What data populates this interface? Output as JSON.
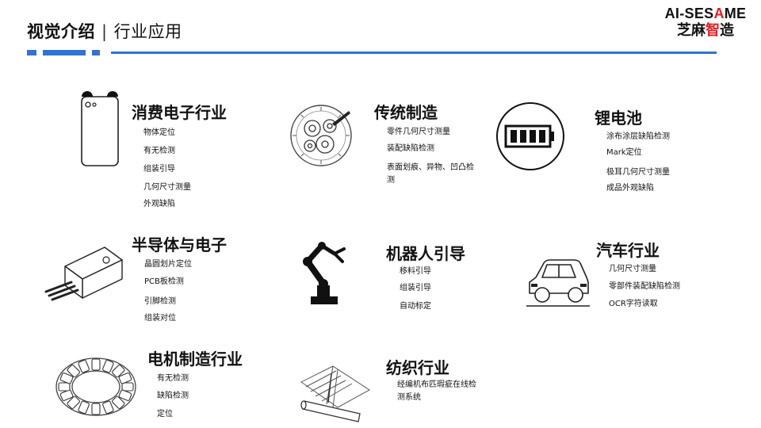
{
  "header": {
    "title": "视觉介绍",
    "separator": "|",
    "subtitle": "行业应用"
  },
  "brand": {
    "en_prefix": "AI-SES",
    "en_mid": "A",
    "en_suffix": "ME",
    "cn_part1": "芝麻",
    "cn_part2": "智",
    "cn_part3": "造"
  },
  "colors": {
    "accent_blue": "#2f73d6",
    "brand_red": "#e51c23",
    "text": "#111111"
  },
  "categories": [
    {
      "icon": "smartphone-icon",
      "title": "消费电子行业",
      "items": [
        "物体定位",
        "有无检测",
        "组装引导",
        "几何尺寸测量",
        "外观缺陷"
      ]
    },
    {
      "icon": "watch-mechanism-icon",
      "title": "传统制造",
      "items": [
        "零件几何尺寸测量",
        "装配缺陷检测",
        "表面划痕、异物、凹凸检测"
      ]
    },
    {
      "icon": "battery-icon",
      "title": "锂电池",
      "items": [
        "涂布涂层缺陷检测",
        "Mark定位",
        "极耳几何尺寸测量",
        "成品外观缺陷"
      ]
    },
    {
      "icon": "transistor-chip-icon",
      "title": "半导体与电子",
      "items": [
        "晶圆划片定位",
        "PCB板检测",
        "引脚检测",
        "组装对位"
      ]
    },
    {
      "icon": "robot-arm-icon",
      "title": "机器人引导",
      "items": [
        "移料引导",
        "组装引导",
        "自动标定"
      ]
    },
    {
      "icon": "car-icon",
      "title": "汽车行业",
      "items": [
        "几何尺寸测量",
        "零部件装配缺陷检测",
        "OCR字符读取"
      ]
    },
    {
      "icon": "motor-stator-icon",
      "title": "电机制造行业",
      "items": [
        "有无检测",
        "缺陷检测",
        "定位"
      ]
    },
    {
      "icon": "fabric-loom-icon",
      "title": "纺织行业",
      "items": [
        "经编机布匹瑕疵在线检测系统"
      ]
    }
  ]
}
